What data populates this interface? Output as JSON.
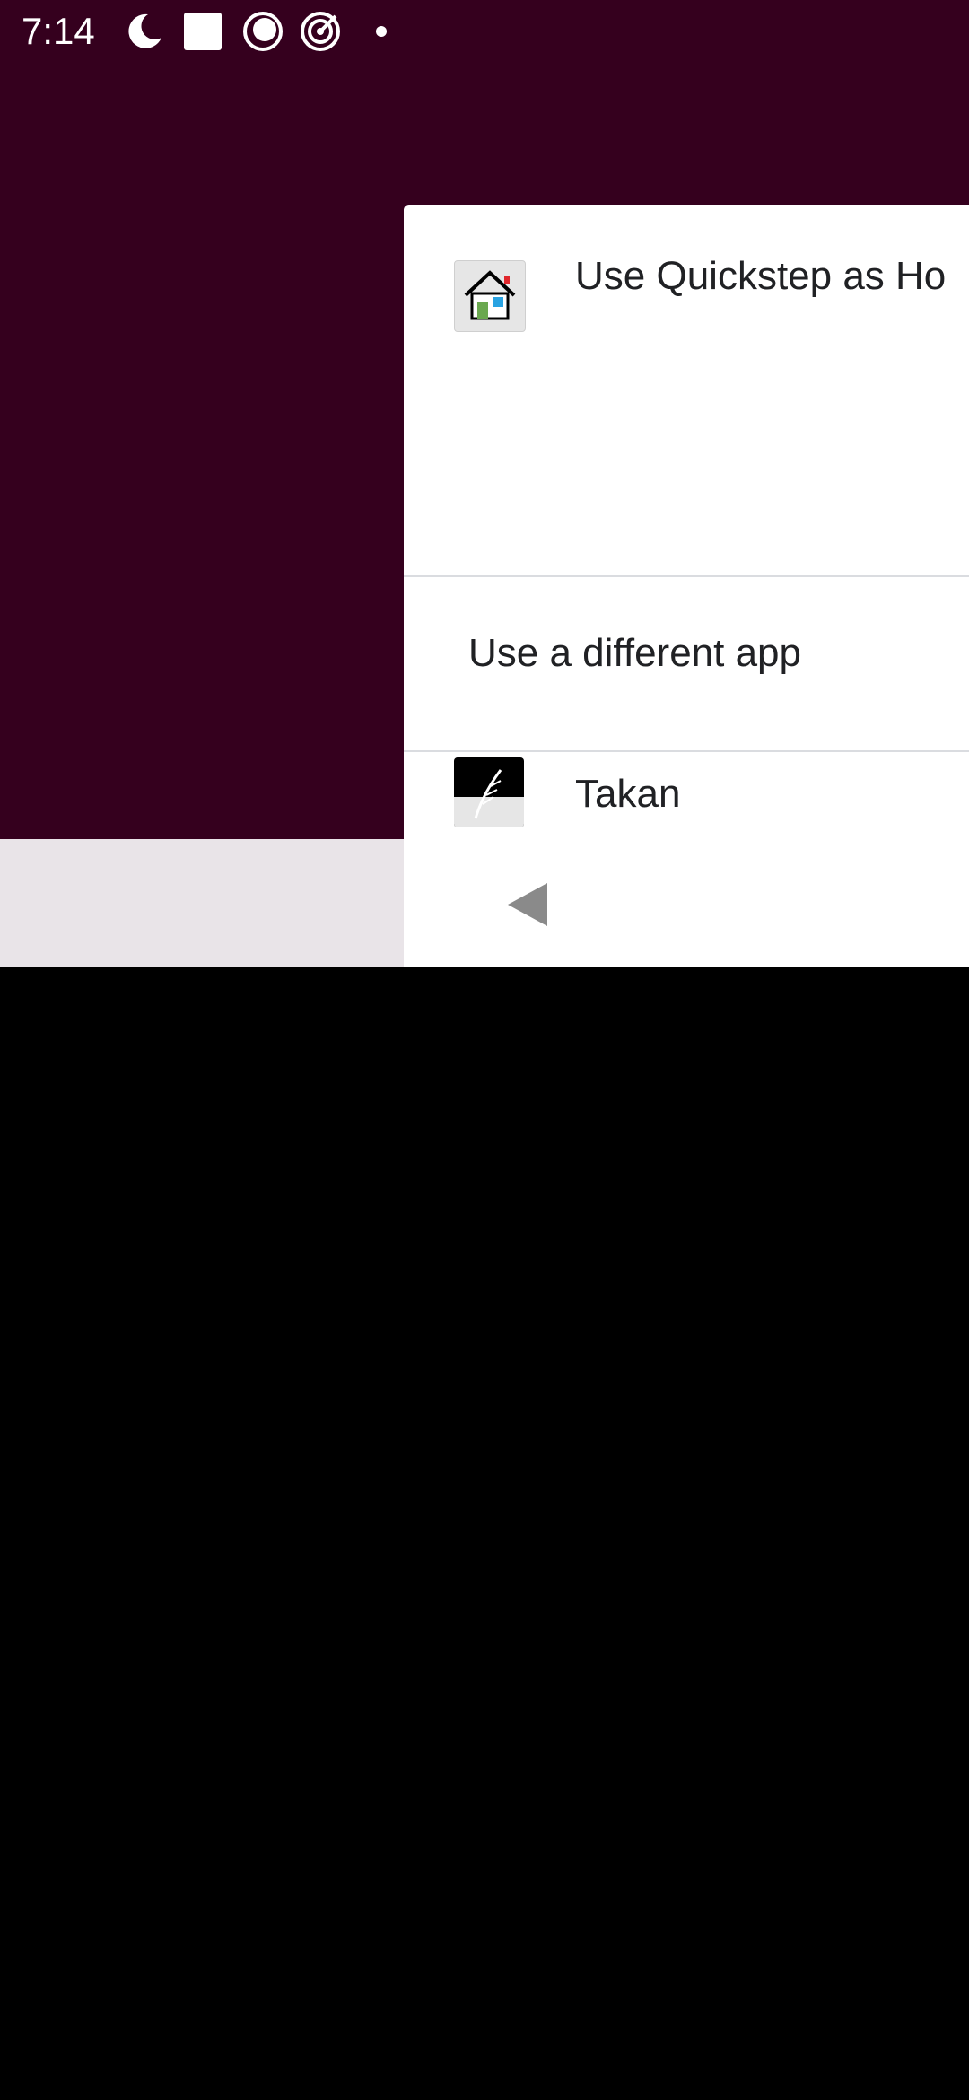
{
  "status_bar": {
    "time": "7:14",
    "icons": [
      "do-not-disturb-icon",
      "square-notification-icon",
      "sync-circle-icon",
      "target-icon",
      "dot-icon"
    ]
  },
  "chooser": {
    "default_option": {
      "label": "Use Quickstep as Ho",
      "icon": "home-launcher-icon"
    },
    "different_app_label": "Use a different app",
    "apps": [
      {
        "label": "Takan",
        "icon": "takan-feather-icon"
      }
    ]
  },
  "navigation": {
    "back_icon": "back-triangle-icon"
  },
  "colors": {
    "wallpaper": "#35001e",
    "sheet": "#ffffff",
    "nav_strip": "#e9e4e8",
    "divider": "#dadce0",
    "text": "#202124"
  }
}
